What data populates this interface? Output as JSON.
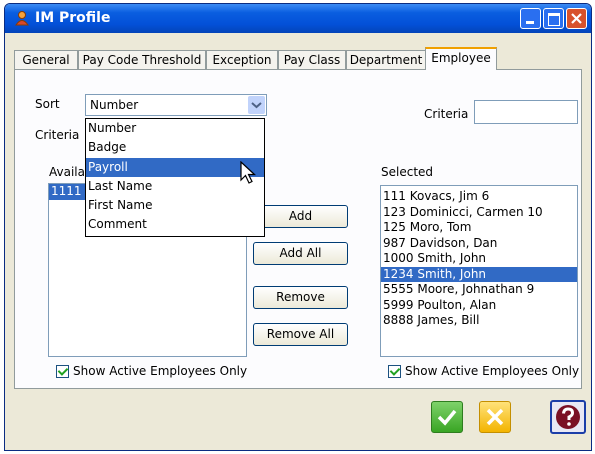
{
  "window": {
    "title": "IM Profile"
  },
  "tabs": [
    {
      "label": "General"
    },
    {
      "label": "Pay Code Threshold"
    },
    {
      "label": "Exception"
    },
    {
      "label": "Pay Class"
    },
    {
      "label": "Department"
    },
    {
      "label": "Employee",
      "active": true
    }
  ],
  "sort": {
    "label": "Sort",
    "value": "Number"
  },
  "criteria_left": {
    "label": "Criteria"
  },
  "criteria_right": {
    "label": "Criteria",
    "value": ""
  },
  "available": {
    "label": "Available",
    "items": [
      "1111"
    ]
  },
  "selected": {
    "label": "Selected",
    "items": [
      "111 Kovacs, Jim 6",
      "123 Dominicci, Carmen 10",
      "125 Moro, Tom",
      "987 Davidson, Dan",
      "1000 Smith, John",
      "1234 Smith, John",
      "5555 Moore, Johnathan 9",
      "5999 Poulton, Alan",
      "8888 James, Bill"
    ],
    "selected_item": "1234 Smith, John"
  },
  "buttons": {
    "add": "Add",
    "add_all": "Add All",
    "remove": "Remove",
    "remove_all": "Remove All"
  },
  "checkboxes": {
    "left": {
      "label": "Show Active Employees Only",
      "checked": true
    },
    "right": {
      "label": "Show Active Employees Only",
      "checked": true
    }
  },
  "dropdown": {
    "options": [
      "Number",
      "Badge",
      "Payroll",
      "Last Name",
      "First Name",
      "Comment"
    ],
    "highlighted": "Payroll"
  },
  "icons": {
    "app": "profile-icon",
    "ok": "check-icon",
    "cancel": "cancel-icon",
    "help": "help-icon"
  },
  "colors": {
    "titlebar": "#0350d8",
    "selection": "#316ac5",
    "active_tab_accent": "#f0a000",
    "ok": "#39a524",
    "cancel": "#f3b400"
  }
}
